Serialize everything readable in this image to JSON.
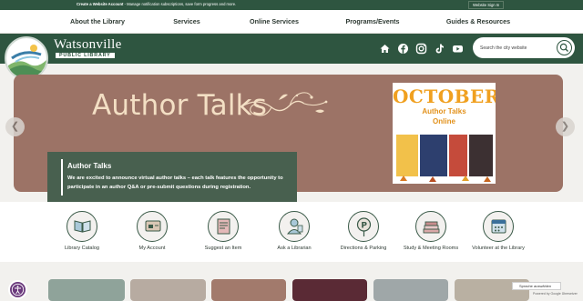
{
  "topbar": {
    "create_link": "Create a Website Account",
    "create_text": " - Manage notification subscriptions, save form progress and more.",
    "signin": "Website Sign In"
  },
  "nav": [
    "About the Library",
    "Services",
    "Online Services",
    "Programs/Events",
    "Guides & Resources"
  ],
  "brand": {
    "name": "Watsonville",
    "subtitle": "PUBLIC LIBRARY"
  },
  "social_icons": [
    "home-icon",
    "facebook-icon",
    "instagram-icon",
    "tiktok-icon",
    "youtube-icon"
  ],
  "search": {
    "placeholder": "Search the city website"
  },
  "hero": {
    "title": "Author Talks",
    "poster_month": "OCTOBER",
    "poster_sub1": "Author Talks",
    "poster_sub2": "Online",
    "caption_title": "Author Talks",
    "caption_text": "We are excited to announce virtual author talks – each talk features the opportunity to participate in an author Q&A or pre-submit questions during registration."
  },
  "quick_links": [
    {
      "label": "Library Catalog",
      "icon": "book-icon"
    },
    {
      "label": "My Account",
      "icon": "library-card-icon"
    },
    {
      "label": "Suggest an Item",
      "icon": "suggest-icon"
    },
    {
      "label": "Ask a Librarian",
      "icon": "librarian-icon"
    },
    {
      "label": "Directions & Parking",
      "icon": "parking-icon"
    },
    {
      "label": "Study & Meeting Rooms",
      "icon": "books-stack-icon"
    },
    {
      "label": "Volunteer at the Library",
      "icon": "calendar-icon"
    }
  ],
  "translate": {
    "label": "Sprache auswählen",
    "powered": "Powered by Google Übersetzer"
  },
  "colors": {
    "brand_green": "#2e5540",
    "hero_bg": "#9c7366",
    "hero_title": "#f3dfc4",
    "poster_orange": "#f0a020"
  }
}
